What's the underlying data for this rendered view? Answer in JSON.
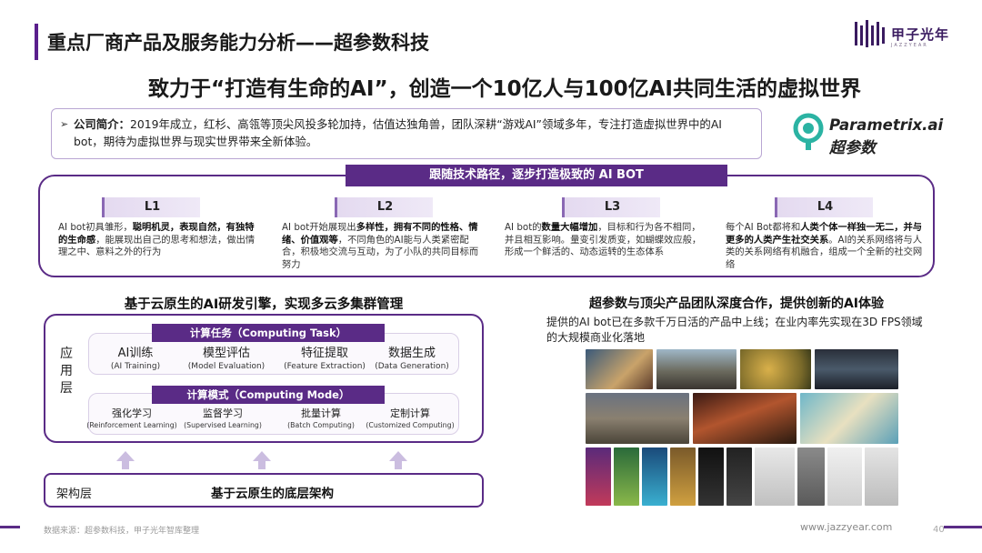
{
  "header": {
    "title": "重点厂商产品及服务能力分析——超参数科技",
    "logo_text": "甲子光年",
    "logo_sub": "JAZZYEAR"
  },
  "headline": "致力于“打造有生命的AI”，创造一个10亿人与100亿AI共同生活的虚拟世界",
  "intro": {
    "label": "公司简介：",
    "text": "2019年成立，红杉、高瓴等顶尖风投多轮加持，估值达独角兽，团队深耕“游戏AI”领域多年，专注打造虚拟世界中的AI bot，期待为虚拟世界与现实世界带来全新体验。"
  },
  "brand": {
    "name_en": "Parametrix.ai",
    "name_cn": "超参数"
  },
  "roadmap": {
    "title": "跟随技术路径，逐步打造极致的 AI BOT",
    "levels": [
      {
        "label": "L1",
        "parts": [
          {
            "t": "AI bot初具雏形，",
            "b": false
          },
          {
            "t": "聪明机灵，表现自然，有独特的生命感",
            "b": true
          },
          {
            "t": "，能展现出自己的思考和想法，做出情理之中、意料之外的行为",
            "b": false
          }
        ]
      },
      {
        "label": "L2",
        "parts": [
          {
            "t": "AI bot开始展现出",
            "b": false
          },
          {
            "t": "多样性，拥有不同的性格、情绪、价值观等",
            "b": true
          },
          {
            "t": "，不同角色的AI能与人类紧密配合，积极地交流与互动，为了小队的共同目标而努力",
            "b": false
          }
        ]
      },
      {
        "label": "L3",
        "parts": [
          {
            "t": "AI bot的",
            "b": false
          },
          {
            "t": "数量大幅增加",
            "b": true
          },
          {
            "t": "，目标和行为各不相同，并且相互影响。量变引发质变，如蝴蝶效应般，形成一个鲜活的、动态运转的生态体系",
            "b": false
          }
        ]
      },
      {
        "label": "L4",
        "parts": [
          {
            "t": "每个AI Bot都将和",
            "b": false
          },
          {
            "t": "人类个体一样独一无二，并与更多的人类产生社交关系",
            "b": true
          },
          {
            "t": "。AI的关系网络将与人类的关系网络有机融合，组成一个全新的社交网络",
            "b": false
          }
        ]
      }
    ]
  },
  "left": {
    "title": "基于云原生的AI研发引擎，实现多云多集群管理",
    "app_layer": "应用层",
    "task_title": "计算任务（Computing Task）",
    "tasks": [
      {
        "cn": "AI训练",
        "en": "(AI Training)"
      },
      {
        "cn": "模型评估",
        "en": "(Model Evaluation)"
      },
      {
        "cn": "特征提取",
        "en": "(Feature Extraction)"
      },
      {
        "cn": "数据生成",
        "en": "(Data Generation)"
      }
    ],
    "mode_title": "计算模式（Computing Mode）",
    "modes": [
      {
        "cn": "强化学习",
        "en": "(Reinforcement Learning)"
      },
      {
        "cn": "监督学习",
        "en": "(Supervised Learning)"
      },
      {
        "cn": "批量计算",
        "en": "(Batch Computing)"
      },
      {
        "cn": "定制计算",
        "en": "(Customized Computing)"
      }
    ],
    "infra_label": "架构层",
    "infra_text": "基于云原生的底层架构"
  },
  "right": {
    "title": "超参数与顶尖产品团队深度合作，提供创新的AI体验",
    "desc": "提供的AI bot已在多款千万日活的产品中上线；在业内率先实现在3D FPS领域的大规模商业化落地"
  },
  "colors": {
    "accent": "#5a2b86"
  },
  "footer": {
    "source": "数据来源：超参数科技，甲子光年智库整理",
    "url": "www.jazzyear.com",
    "page": "40"
  }
}
